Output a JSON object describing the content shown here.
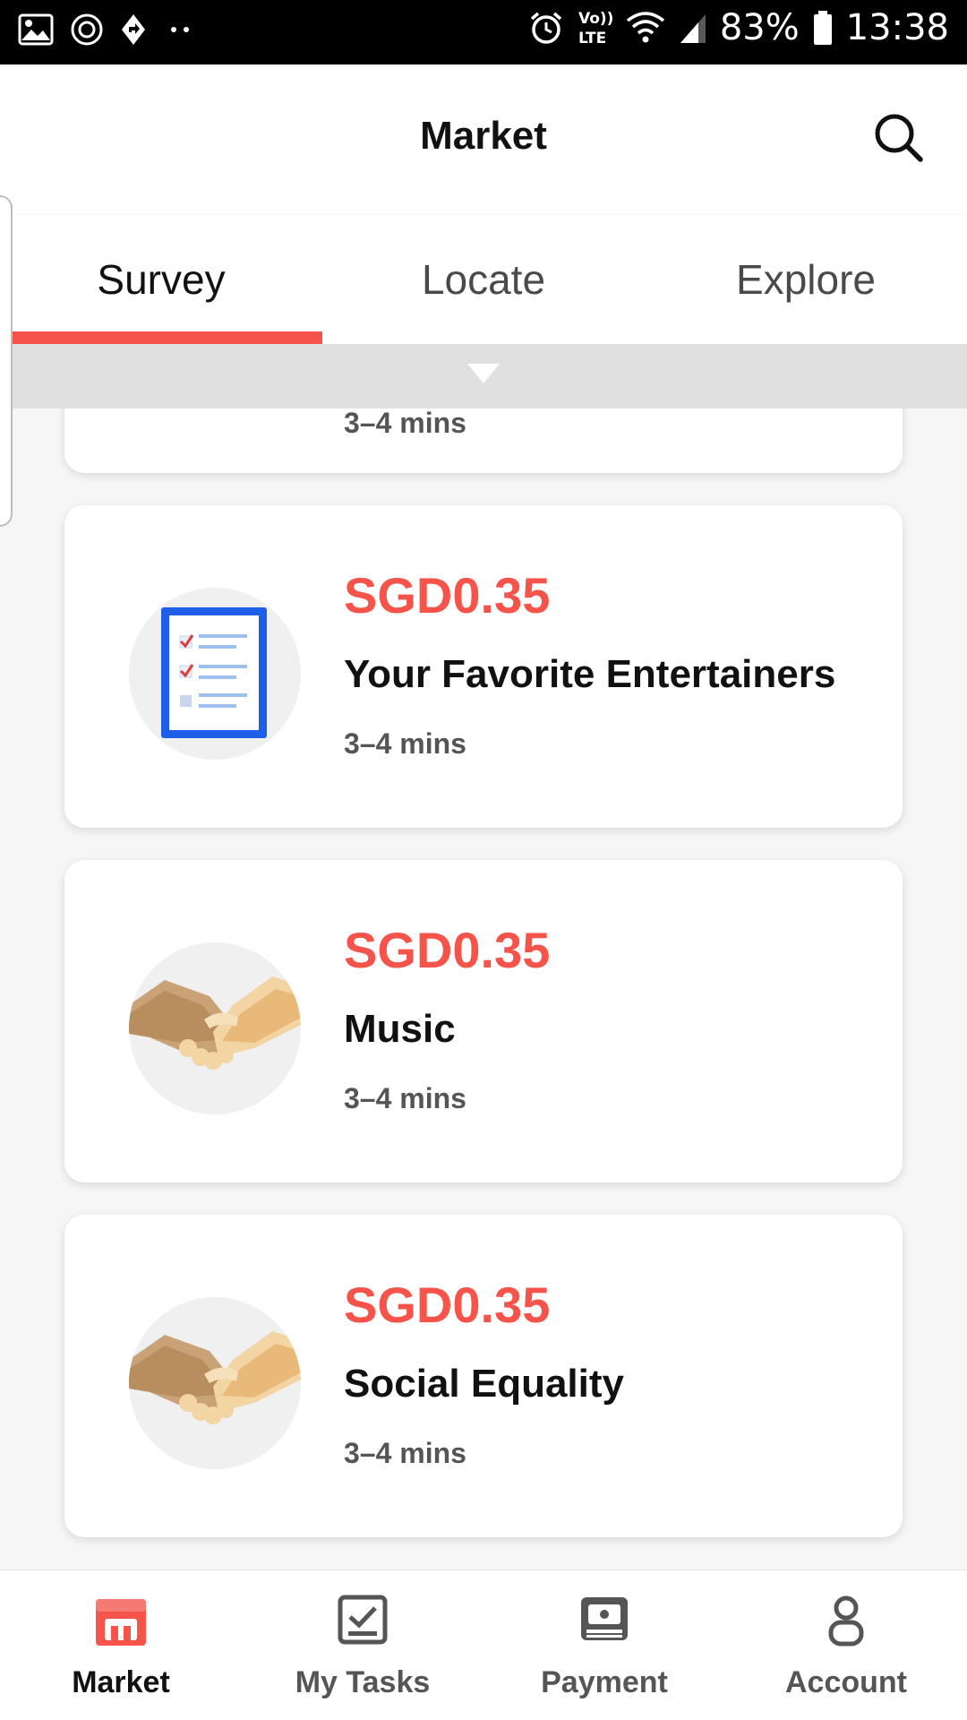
{
  "status_bar": {
    "battery": "83%",
    "time": "13:38",
    "network": "LTE",
    "icons_left": [
      "image-icon",
      "circle-icon",
      "direction-icon",
      "more-dots-icon"
    ],
    "icons_right": [
      "alarm-icon",
      "volte-icon",
      "wifi-icon",
      "signal-icon",
      "battery-icon"
    ]
  },
  "header": {
    "title": "Market",
    "search_icon": "search-icon"
  },
  "tabs": [
    {
      "label": "Survey",
      "active": true
    },
    {
      "label": "Locate",
      "active": false
    },
    {
      "label": "Explore",
      "active": false
    }
  ],
  "colors": {
    "accent": "#f6544a",
    "title": "#111111",
    "muted": "#555555"
  },
  "cards": [
    {
      "partial": true,
      "duration": "3–4 mins"
    },
    {
      "price": "SGD0.35",
      "title": "Your Favorite Entertainers",
      "duration": "3–4 mins",
      "icon": "checklist-icon"
    },
    {
      "price": "SGD0.35",
      "title": "Music",
      "duration": "3–4 mins",
      "icon": "handshake-icon"
    },
    {
      "price": "SGD0.35",
      "title": "Social Equality",
      "duration": "3–4 mins",
      "icon": "handshake-icon"
    }
  ],
  "bottom_nav": [
    {
      "label": "Market",
      "icon": "store-icon",
      "active": true
    },
    {
      "label": "My Tasks",
      "icon": "tasks-icon",
      "active": false
    },
    {
      "label": "Payment",
      "icon": "wallet-icon",
      "active": false
    },
    {
      "label": "Account",
      "icon": "person-icon",
      "active": false
    }
  ]
}
